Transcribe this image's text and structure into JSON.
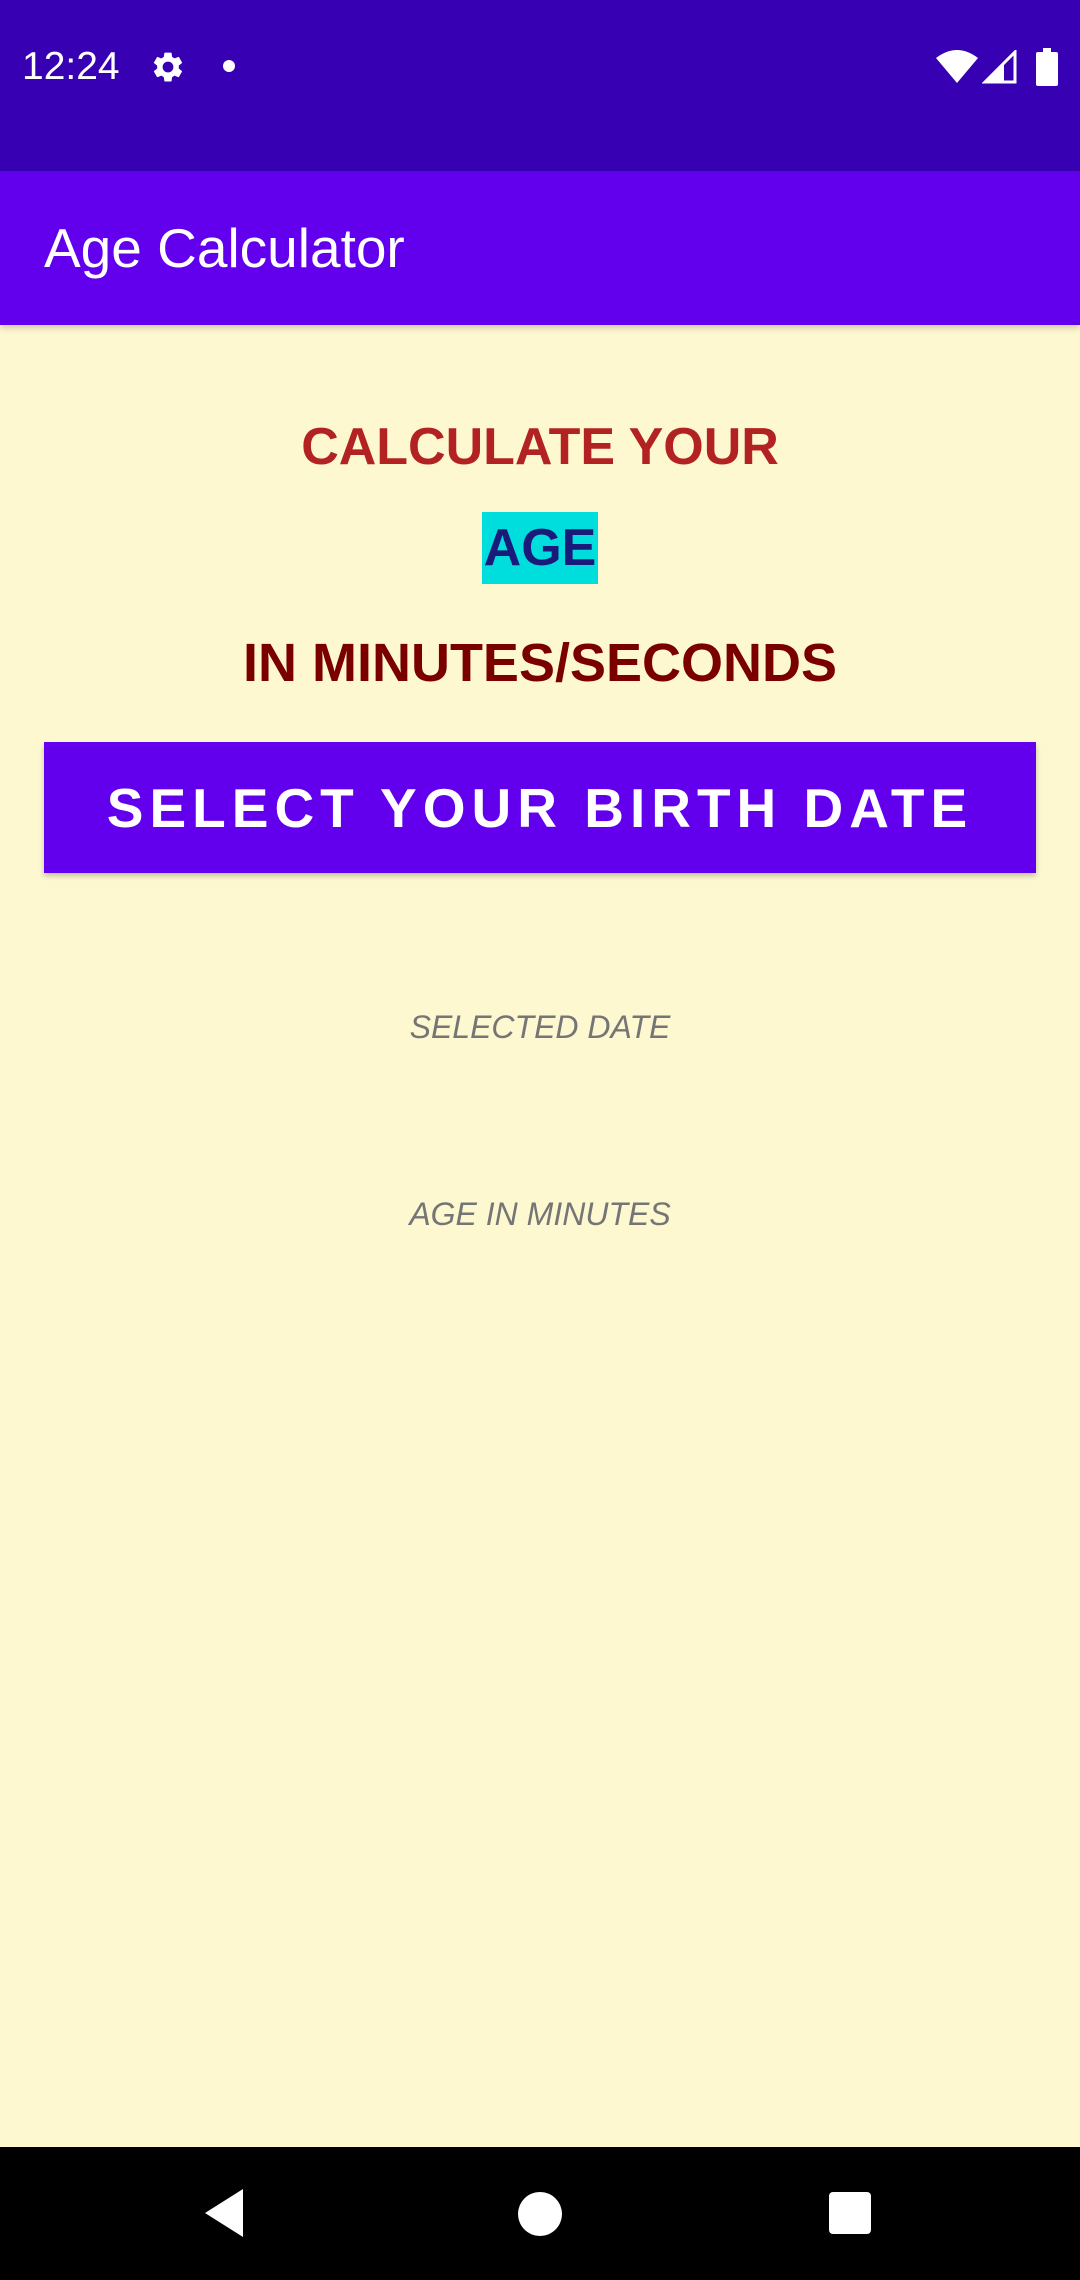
{
  "status_bar": {
    "time": "12:24",
    "icons": [
      "gear-icon",
      "notification-dot-icon",
      "wifi-icon",
      "cell-signal-icon",
      "battery-icon"
    ],
    "background": "#3700b3"
  },
  "app_bar": {
    "title": "Age Calculator",
    "background": "#6200ee"
  },
  "main": {
    "heading_line1": "CALCULATE YOUR",
    "heading_line2": "AGE",
    "heading_line3": "IN MINUTES/SECONDS",
    "select_button_label": "SELECT YOUR BIRTH DATE",
    "selected_date_label": "SELECTED DATE",
    "age_in_minutes_label": "AGE IN MINUTES",
    "colors": {
      "background": "#fdf8d0",
      "heading1": "#b22222",
      "age_highlight": "#00dddd",
      "age_text": "#1a1a7a",
      "heading3": "#7a0000",
      "button": "#6200ee"
    }
  },
  "nav_bar": {
    "icons": [
      "back-icon",
      "home-icon",
      "recents-icon"
    ]
  }
}
